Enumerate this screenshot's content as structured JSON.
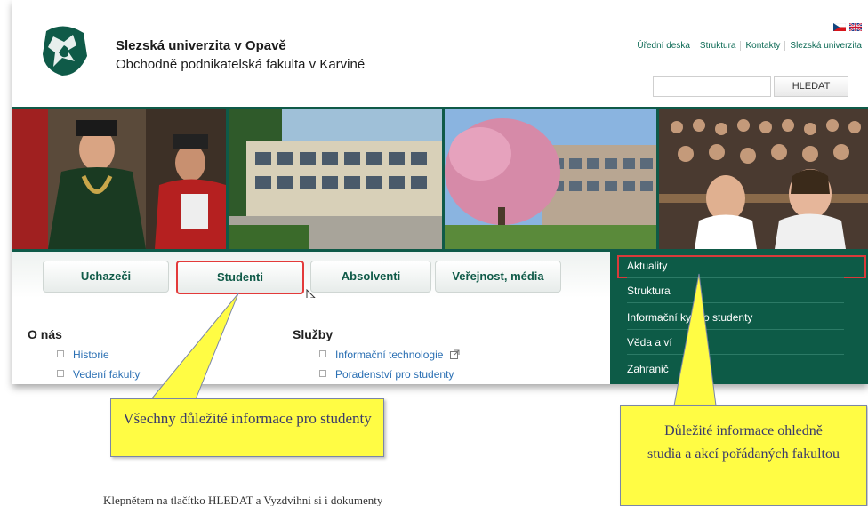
{
  "header": {
    "university": "Slezská univerzita v Opavě",
    "faculty": "Obchodně podnikatelská fakulta v Karviné",
    "links": [
      "Úřední deska",
      "Struktura",
      "Kontakty",
      "Slezská univerzita"
    ],
    "search_placeholder": "",
    "search_button": "HLEDAT",
    "flags": [
      "czech-flag-icon",
      "uk-flag-icon"
    ]
  },
  "nav": {
    "tabs": [
      {
        "label": "Uchazeči"
      },
      {
        "label": "Studenti"
      },
      {
        "label": "Absolventi"
      },
      {
        "label": "Veřejnost, média"
      }
    ],
    "selected": "Studenti"
  },
  "sidebar": {
    "items": [
      {
        "label": "Aktuality"
      },
      {
        "label": "Struktura"
      },
      {
        "label": "Informační systémy pro studenty"
      },
      {
        "label": "Věda a výzkum"
      },
      {
        "label": "Zahraničí"
      }
    ],
    "visible_items": [
      "Aktuality",
      "Struktura",
      "Informační       ky pro studenty",
      "Věda a ví",
      "Zahranič"
    ]
  },
  "content": {
    "o_nas": {
      "title": "O nás",
      "items": [
        "Historie",
        "Vedení fakulty"
      ]
    },
    "sluzby": {
      "title": "Služby",
      "items": [
        "Informační technologie",
        "Poradenství pro studenty"
      ]
    }
  },
  "callouts": {
    "left": "Všechny důležité informace pro studenty",
    "right": "Důležité informace ohledně studia a akcí pořádaných fakultou"
  },
  "bottom_text": "Klepnětem na tlačítko HLEDAT a Vyzdvihni si i dokumenty",
  "colors": {
    "brand_green": "#0d5b47",
    "link_green": "#0c6a55",
    "highlight_red": "#e33a3a",
    "callout_yellow": "#fffc44"
  }
}
